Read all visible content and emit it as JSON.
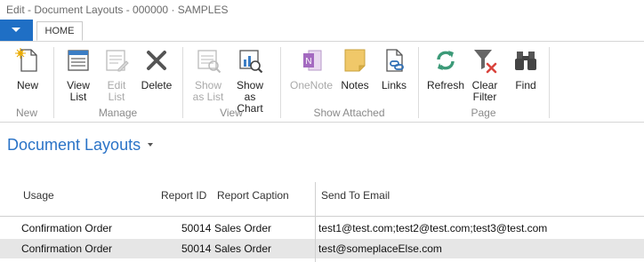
{
  "window": {
    "title": "Edit - Document Layouts - 000000 · SAMPLES"
  },
  "ribbon": {
    "tab": "HOME",
    "groups": {
      "new": "New",
      "manage": "Manage",
      "view": "View",
      "show_attached": "Show Attached",
      "page": "Page"
    },
    "buttons": {
      "new": "New",
      "view_list": "View\nList",
      "edit_list": "Edit\nList",
      "delete": "Delete",
      "show_as_list": "Show\nas List",
      "show_as_chart": "Show as\nChart",
      "onenote": "OneNote",
      "notes": "Notes",
      "links": "Links",
      "refresh": "Refresh",
      "clear_filter": "Clear\nFilter",
      "find": "Find"
    }
  },
  "page": {
    "title": "Document Layouts"
  },
  "table": {
    "columns": {
      "usage": "Usage",
      "report_id": "Report ID",
      "report_caption": "Report Caption",
      "send_to_email": "Send To Email"
    },
    "rows": [
      {
        "usage": "Confirmation Order",
        "report_id": "50014",
        "report_caption": "Sales Order",
        "send_to_email": "test1@test.com;test2@test.com;test3@test.com"
      },
      {
        "usage": "Confirmation Order",
        "report_id": "50014",
        "report_caption": "Sales Order",
        "send_to_email": "test@someplaceElse.com"
      }
    ]
  },
  "colors": {
    "accent": "#1f6fc5",
    "title_blue": "#2a73c7",
    "disabled": "#a9a9a9",
    "selected_row": "#e6e6e6"
  }
}
